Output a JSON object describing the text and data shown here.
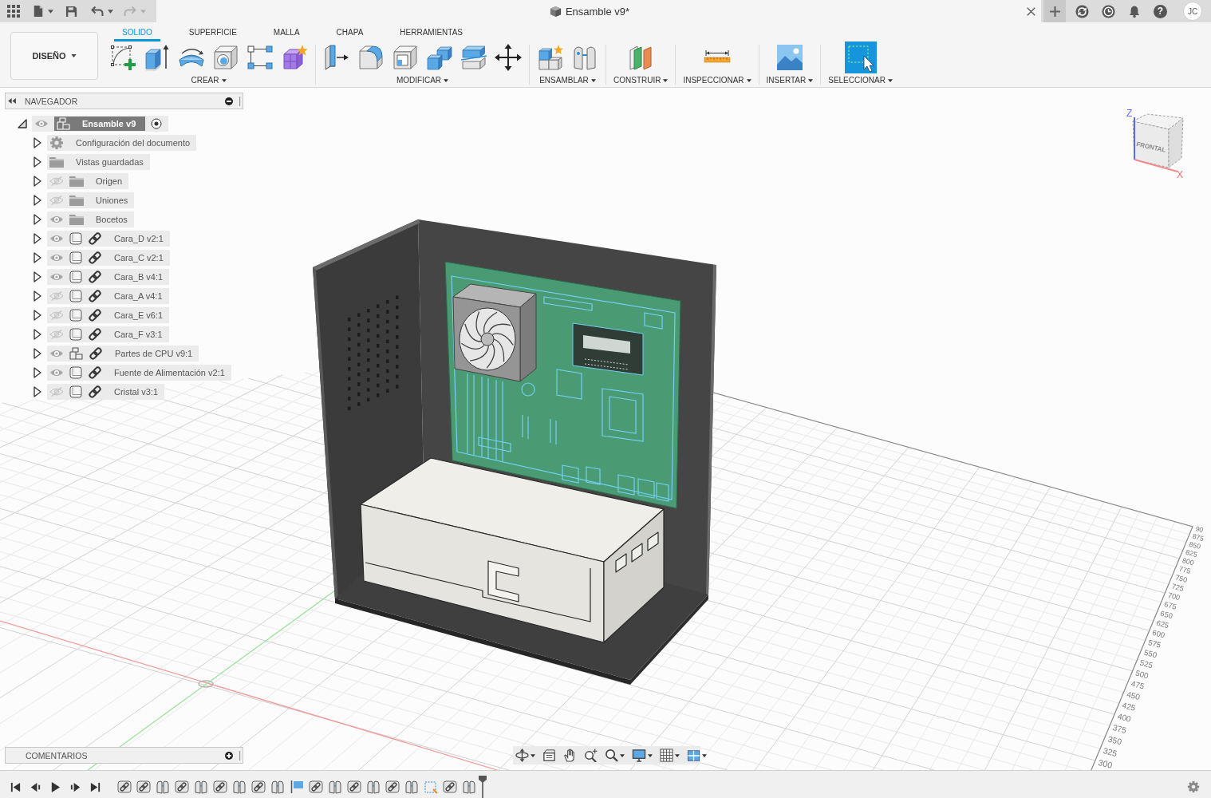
{
  "quick_access": [
    {
      "kind": "apps",
      "menu": false,
      "disabled": false
    },
    {
      "kind": "file",
      "menu": true,
      "disabled": false
    },
    {
      "kind": "save",
      "menu": false,
      "disabled": false
    },
    {
      "kind": "undo",
      "menu": true,
      "disabled": false
    },
    {
      "kind": "redo",
      "menu": true,
      "disabled": true
    }
  ],
  "document_tab": {
    "title": "Ensamble v9*"
  },
  "header_actions": [
    {
      "kind": "new_tab"
    },
    {
      "kind": "sync"
    },
    {
      "kind": "history"
    },
    {
      "kind": "notifications"
    },
    {
      "kind": "help",
      "label": "?"
    }
  ],
  "user": {
    "initials": "JC"
  },
  "workspace": {
    "label": "DISEÑO"
  },
  "tabs": [
    {
      "label": "SOLIDO",
      "selected": true
    },
    {
      "label": "SUPERFICIE",
      "selected": false
    },
    {
      "label": "MALLA",
      "selected": false
    },
    {
      "label": "CHAPA",
      "selected": false
    },
    {
      "label": "HERRAMIENTAS",
      "selected": false
    }
  ],
  "tool_groups": [
    {
      "label": "CREAR",
      "tools": [
        {
          "kind": "sketch"
        },
        {
          "kind": "extrude"
        },
        {
          "kind": "revolve"
        },
        {
          "kind": "hole"
        },
        {
          "kind": "pattern"
        },
        {
          "kind": "form"
        }
      ]
    },
    {
      "label": "MODIFICAR",
      "tools": [
        {
          "kind": "press_pull"
        },
        {
          "kind": "fillet"
        },
        {
          "kind": "shell"
        },
        {
          "kind": "combine"
        },
        {
          "kind": "split"
        },
        {
          "kind": "move"
        }
      ]
    },
    {
      "label": "ENSAMBLAR",
      "tools": [
        {
          "kind": "new_component"
        },
        {
          "kind": "joint"
        }
      ]
    },
    {
      "label": "CONSTRUIR",
      "tools": [
        {
          "kind": "plane"
        }
      ]
    },
    {
      "label": "INSPECCIONAR",
      "tools": [
        {
          "kind": "measure"
        }
      ]
    },
    {
      "label": "INSERTAR",
      "tools": [
        {
          "kind": "image"
        }
      ]
    },
    {
      "label": "SELECCIONAR",
      "tools": [
        {
          "kind": "select"
        }
      ]
    }
  ],
  "navigator": {
    "title": "NAVEGADOR",
    "tree": [
      {
        "label": "Ensamble v9",
        "kind": "assembly",
        "visible": true,
        "expanded": true,
        "active": true,
        "children": [
          {
            "label": "Configuración del documento",
            "kind": "settings",
            "expanded": false
          },
          {
            "label": "Vistas guardadas",
            "kind": "folder",
            "expanded": false
          },
          {
            "label": "Origen",
            "kind": "folder",
            "visible": false,
            "expanded": false
          },
          {
            "label": "Uniones",
            "kind": "folder",
            "visible": false,
            "expanded": false
          },
          {
            "label": "Bocetos",
            "kind": "folder",
            "visible": true,
            "expanded": false
          },
          {
            "label": "Cara_D v2:1",
            "kind": "component",
            "visible": true,
            "expanded": false,
            "linked": true
          },
          {
            "label": "Cara_C v2:1",
            "kind": "component",
            "visible": true,
            "expanded": false,
            "linked": true
          },
          {
            "label": "Cara_B v4:1",
            "kind": "component",
            "visible": true,
            "expanded": false,
            "linked": true
          },
          {
            "label": "Cara_A v4:1",
            "kind": "component",
            "visible": false,
            "expanded": false,
            "linked": true
          },
          {
            "label": "Cara_E v6:1",
            "kind": "component",
            "visible": false,
            "expanded": false,
            "linked": true
          },
          {
            "label": "Cara_F v3:1",
            "kind": "component",
            "visible": false,
            "expanded": false,
            "linked": true
          },
          {
            "label": "Partes de CPU v9:1",
            "kind": "assembly",
            "visible": true,
            "expanded": false,
            "linked": true
          },
          {
            "label": "Fuente de Alimentación v2:1",
            "kind": "component",
            "visible": true,
            "expanded": false,
            "linked": true
          },
          {
            "label": "Cristal v3:1",
            "kind": "component",
            "visible": false,
            "expanded": false,
            "linked": true
          }
        ]
      }
    ]
  },
  "comments": {
    "title": "COMENTARIOS"
  },
  "view_cube": {
    "front_label": "FRONTAL",
    "z_label": "Z",
    "x_label": "X"
  },
  "grid": {
    "ruler_labels": [
      "90",
      "875",
      "850",
      "825",
      "800",
      "775",
      "750",
      "725",
      "700",
      "675",
      "650",
      "625",
      "600",
      "575",
      "550",
      "525",
      "500",
      "475",
      "450",
      "425",
      "400",
      "375",
      "350",
      "325",
      "300"
    ]
  },
  "view_controls": [
    {
      "kind": "orbit",
      "menu": true
    },
    {
      "kind": "look_at",
      "menu": false
    },
    {
      "kind": "pan",
      "menu": false
    },
    {
      "kind": "zoom_window",
      "menu": false
    },
    {
      "kind": "zoom",
      "menu": true
    },
    {
      "kind": "display",
      "menu": true
    },
    {
      "kind": "grid",
      "menu": true
    },
    {
      "kind": "viewports",
      "menu": true
    }
  ],
  "timeline": {
    "controls": [
      {
        "kind": "first"
      },
      {
        "kind": "previous"
      },
      {
        "kind": "play"
      },
      {
        "kind": "next"
      },
      {
        "kind": "last"
      }
    ],
    "features": [
      {
        "kind": "joint"
      },
      {
        "kind": "joint"
      },
      {
        "kind": "motion"
      },
      {
        "kind": "joint"
      },
      {
        "kind": "motion"
      },
      {
        "kind": "joint"
      },
      {
        "kind": "motion"
      },
      {
        "kind": "joint"
      },
      {
        "kind": "motion"
      },
      {
        "kind": "sketch"
      },
      {
        "kind": "joint"
      },
      {
        "kind": "motion"
      },
      {
        "kind": "joint"
      },
      {
        "kind": "motion"
      },
      {
        "kind": "joint"
      },
      {
        "kind": "motion"
      },
      {
        "kind": "selection"
      },
      {
        "kind": "joint"
      },
      {
        "kind": "motion"
      }
    ]
  }
}
